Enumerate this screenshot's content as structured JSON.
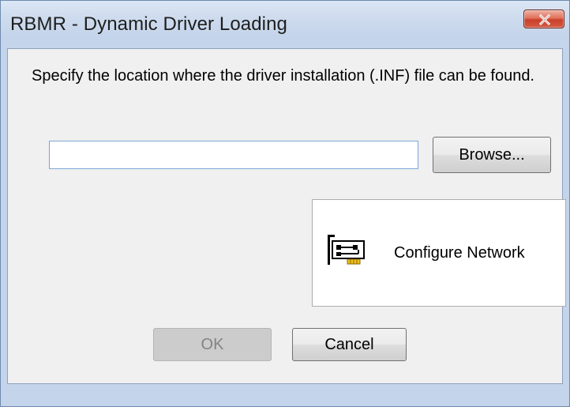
{
  "window": {
    "title": "RBMR - Dynamic Driver Loading",
    "close_icon": "close-icon"
  },
  "instruction": "Specify the location where the driver installation (.INF) file can be found.",
  "path_input": {
    "value": "",
    "placeholder": ""
  },
  "buttons": {
    "browse": "Browse...",
    "configure_network": "Configure Network",
    "configure_network_icon": "network-card-icon",
    "ok": "OK",
    "ok_enabled": false,
    "cancel": "Cancel"
  },
  "colors": {
    "titlebar": "#c4d4ea",
    "close_button": "#c8402b",
    "input_border": "#7aa7d6",
    "disabled_button": "#cccccc"
  }
}
